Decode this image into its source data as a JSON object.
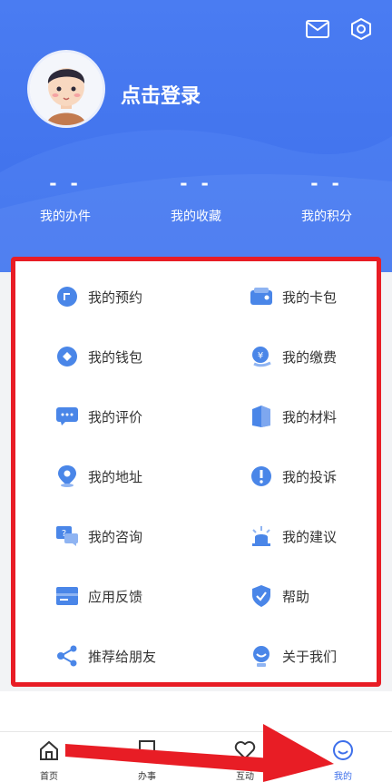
{
  "header": {
    "login_text": "点击登录",
    "icons": [
      "mail-icon",
      "settings-icon"
    ]
  },
  "stats": [
    {
      "value": "- -",
      "label": "我的办件"
    },
    {
      "value": "- -",
      "label": "我的收藏"
    },
    {
      "value": "- -",
      "label": "我的积分"
    }
  ],
  "menu": {
    "left": [
      {
        "label": "我的预约",
        "icon": "appointment-icon"
      },
      {
        "label": "我的钱包",
        "icon": "wallet-icon"
      },
      {
        "label": "我的评价",
        "icon": "comment-icon"
      },
      {
        "label": "我的地址",
        "icon": "location-icon"
      },
      {
        "label": "我的咨询",
        "icon": "consult-icon"
      },
      {
        "label": "应用反馈",
        "icon": "feedback-icon"
      },
      {
        "label": "推荐给朋友",
        "icon": "share-icon"
      }
    ],
    "right": [
      {
        "label": "我的卡包",
        "icon": "card-wallet-icon"
      },
      {
        "label": "我的缴费",
        "icon": "payment-icon"
      },
      {
        "label": "我的材料",
        "icon": "materials-icon"
      },
      {
        "label": "我的投诉",
        "icon": "complaint-icon"
      },
      {
        "label": "我的建议",
        "icon": "suggestion-icon"
      },
      {
        "label": "帮助",
        "icon": "help-shield-icon"
      },
      {
        "label": "关于我们",
        "icon": "about-icon"
      }
    ]
  },
  "tabs": [
    {
      "label": "首页",
      "icon": "home-icon",
      "active": false
    },
    {
      "label": "办事",
      "icon": "tasks-icon",
      "active": false
    },
    {
      "label": "互动",
      "icon": "interact-icon",
      "active": false
    },
    {
      "label": "我的",
      "icon": "profile-icon",
      "active": true
    }
  ],
  "colors": {
    "header_blue": "#3d6fea",
    "icon_blue": "#4a86e8",
    "highlight_red": "#e81d25"
  }
}
